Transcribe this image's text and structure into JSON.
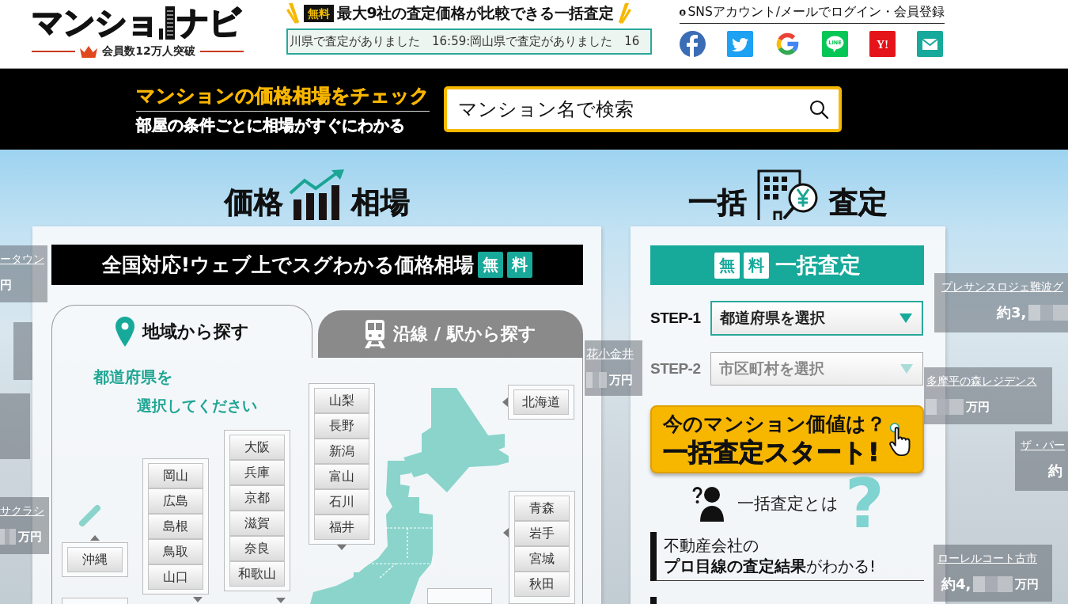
{
  "header": {
    "logo": {
      "name_parts": [
        "マンショ",
        "ナビ"
      ],
      "tagline": "会員数**12**万人突破"
    },
    "promo": {
      "badge": "無料",
      "text": "最大**9**社の査定価格が比較できる一括査定"
    },
    "ticker": "川県で査定がありました　16:59:岡山県で査定がありました　16",
    "login": {
      "label": "SNSアカウント/メールでログイン・会員登録"
    },
    "social": [
      {
        "kind": "facebook"
      },
      {
        "kind": "twitter"
      },
      {
        "kind": "google"
      },
      {
        "kind": "line",
        "label": "LINE"
      },
      {
        "kind": "yahoo",
        "label": "Y!"
      },
      {
        "kind": "mail"
      }
    ]
  },
  "search_bar": {
    "headline": "マンションの価格相場をチェック",
    "subline": "部屋の条件ごとに相場がすぐにわかる",
    "search": {
      "placeholder": "マンション名で検索"
    }
  },
  "background_markers": [
    {
      "name": "ータウン",
      "unit": "円",
      "digits_hidden": false
    },
    {
      "name": "プレサンスロジェ難波グ",
      "price": "約3,",
      "digits_hidden": true
    },
    {
      "name": "花小金井",
      "digits_hidden": true,
      "unit": "万円"
    },
    {
      "name": "多摩平の森レジデンス",
      "digits_hidden": true,
      "unit": "万円"
    },
    {
      "name": "ザ・パー",
      "price": "約",
      "digits_hidden": false
    },
    {
      "name": "サクラシ",
      "digits_hidden": true,
      "unit": "万円"
    },
    {
      "name": "ローレルコート古市",
      "price": "約4,",
      "digits_hidden": true,
      "unit": "万円"
    }
  ],
  "price_section": {
    "heading": [
      "価格",
      "相場"
    ],
    "banner": "全国対応!ウェブ上でスグわかる価格相場",
    "badges": [
      "無",
      "料"
    ],
    "tabs": [
      {
        "kind": "region",
        "label": "**地域**から探す",
        "selected": true
      },
      {
        "kind": "railway",
        "label": "**沿線 / 駅**から探す",
        "selected": false
      }
    ],
    "prompt": [
      "**都道府県**を",
      "選択してください"
    ],
    "prefecture_groups": [
      {
        "kind": "up",
        "buttons": [
          "沖縄"
        ]
      },
      {
        "kind": "down",
        "buttons": [
          "岡山",
          "広島",
          "島根",
          "鳥取",
          "山口"
        ]
      },
      {
        "kind": "down",
        "buttons": [
          "大阪",
          "兵庫",
          "京都",
          "滋賀",
          "奈良",
          "和歌山"
        ]
      },
      {
        "kind": "down",
        "buttons": [
          "山梨",
          "長野",
          "新潟",
          "富山",
          "石川",
          "福井"
        ]
      },
      {
        "kind": "left",
        "buttons": [
          "北海道"
        ]
      },
      {
        "kind": "left",
        "buttons": [
          "青森",
          "岩手",
          "宮城",
          "秋田"
        ]
      }
    ]
  },
  "assessment_section": {
    "heading": [
      "一括",
      "査定"
    ],
    "badges": [
      "無",
      "料"
    ],
    "banner": "一括査定",
    "steps": [
      {
        "label": "STEP-1",
        "prompt": "都道府県を選択",
        "disabled": false
      },
      {
        "label": "STEP-2",
        "prompt": "市区町村を選択",
        "disabled": true
      }
    ],
    "cta": {
      "lines": [
        "今のマンション価値は？",
        "一括査定スタート!"
      ]
    },
    "about": {
      "label": "一括査定とは",
      "mark": "?"
    },
    "features": [
      {
        "lines": [
          "不動産会社の",
          "**プロ目線の査定結果**がわかる!"
        ]
      }
    ]
  }
}
